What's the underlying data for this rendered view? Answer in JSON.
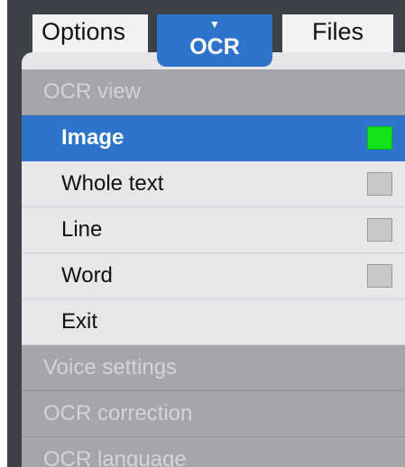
{
  "tabs": {
    "options": "Options",
    "ocr": "OCR",
    "ocr_indicator": "▼",
    "files": "Files"
  },
  "menu": {
    "group_ocr_view": "OCR view",
    "items": [
      {
        "label": "Image",
        "selected": true,
        "checkbox": "green"
      },
      {
        "label": "Whole text",
        "selected": false,
        "checkbox": "gray"
      },
      {
        "label": "Line",
        "selected": false,
        "checkbox": "gray"
      },
      {
        "label": "Word",
        "selected": false,
        "checkbox": "gray"
      },
      {
        "label": "Exit",
        "selected": false
      }
    ],
    "group_voice": "Voice settings",
    "group_correction": "OCR correction",
    "group_language": "OCR language"
  },
  "colors": {
    "accent": "#2f74cc",
    "active_indicator": "#11e21a",
    "inactive_indicator": "#c8c8ca"
  }
}
